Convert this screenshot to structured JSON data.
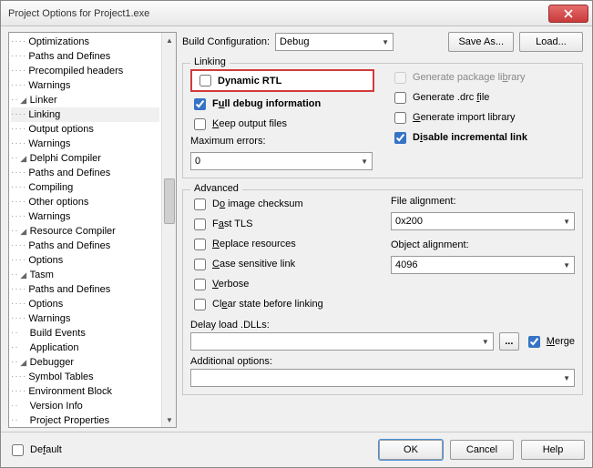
{
  "window": {
    "title": "Project Options for Project1.exe"
  },
  "tree": [
    {
      "indent": 2,
      "label": "Optimizations"
    },
    {
      "indent": 2,
      "label": "Paths and Defines"
    },
    {
      "indent": 2,
      "label": "Precompiled headers"
    },
    {
      "indent": 2,
      "label": "Warnings"
    },
    {
      "indent": 1,
      "label": "Linker",
      "expander": "▾"
    },
    {
      "indent": 2,
      "label": "Linking",
      "selected": true
    },
    {
      "indent": 2,
      "label": "Output options"
    },
    {
      "indent": 2,
      "label": "Warnings"
    },
    {
      "indent": 1,
      "label": "Delphi Compiler",
      "expander": "▾"
    },
    {
      "indent": 2,
      "label": "Paths and Defines"
    },
    {
      "indent": 2,
      "label": "Compiling"
    },
    {
      "indent": 2,
      "label": "Other options"
    },
    {
      "indent": 2,
      "label": "Warnings"
    },
    {
      "indent": 1,
      "label": "Resource Compiler",
      "expander": "▾"
    },
    {
      "indent": 2,
      "label": "Paths and Defines"
    },
    {
      "indent": 2,
      "label": "Options"
    },
    {
      "indent": 1,
      "label": "Tasm",
      "expander": "▾"
    },
    {
      "indent": 2,
      "label": "Paths and Defines"
    },
    {
      "indent": 2,
      "label": "Options"
    },
    {
      "indent": 2,
      "label": "Warnings"
    },
    {
      "indent": 1,
      "label": "Build Events"
    },
    {
      "indent": 1,
      "label": "Application"
    },
    {
      "indent": 1,
      "label": "Debugger",
      "expander": "▾"
    },
    {
      "indent": 2,
      "label": "Symbol Tables"
    },
    {
      "indent": 2,
      "label": "Environment Block"
    },
    {
      "indent": 1,
      "label": "Version Info"
    },
    {
      "indent": 1,
      "label": "Project Properties"
    }
  ],
  "topbar": {
    "build_label": "Build Configuration:",
    "build_value": "Debug",
    "save_as": "Save As...",
    "load": "Load..."
  },
  "linking": {
    "title": "Linking",
    "dynamic_rtl": {
      "pre": "D",
      "mid": "y",
      "post": "namic RTL",
      "checked": false
    },
    "full_debug": {
      "pre": "F",
      "mid": "u",
      "post": "ll debug information",
      "checked": true
    },
    "keep_output": {
      "pre": "",
      "mid": "K",
      "post": "eep output files",
      "checked": false
    },
    "gen_pkg": {
      "pre": "Generate package li",
      "mid": "b",
      "post": "rary",
      "checked": false,
      "disabled": true
    },
    "gen_drc": {
      "pre": "Generate .drc ",
      "mid": "f",
      "post": "ile",
      "checked": false
    },
    "gen_import": {
      "pre": "",
      "mid": "G",
      "post": "enerate import library",
      "checked": false
    },
    "disable_inc": {
      "pre": "D",
      "mid": "i",
      "post": "sable incremental link",
      "checked": true
    },
    "max_errors_label": {
      "pre": "Ma",
      "mid": "x",
      "post": "imum errors:"
    },
    "max_errors_value": "0"
  },
  "advanced": {
    "title": "Advanced",
    "do_image": {
      "pre": "D",
      "mid": "o",
      "post": " image checksum",
      "checked": false
    },
    "fast_tls": {
      "pre": "F",
      "mid": "a",
      "post": "st TLS",
      "checked": false
    },
    "replace": {
      "pre": "",
      "mid": "R",
      "post": "eplace resources",
      "checked": false
    },
    "case_sens": {
      "pre": "",
      "mid": "C",
      "post": "ase sensitive link",
      "checked": false
    },
    "verbose": {
      "pre": "",
      "mid": "V",
      "post": "erbose",
      "checked": false
    },
    "clear_state": {
      "pre": "Cl",
      "mid": "e",
      "post": "ar state before linking",
      "checked": false
    },
    "file_align_label": {
      "pre": "File alig",
      "mid": "n",
      "post": "ment:"
    },
    "file_align_value": "0x200",
    "obj_align_label": {
      "pre": "Ob",
      "mid": "j",
      "post": "ect alignment:"
    },
    "obj_align_value": "4096",
    "delay_label": {
      "pre": "Delay loa",
      "mid": "d",
      "post": " .DLLs:"
    },
    "delay_value": "",
    "browse": "...",
    "merge": {
      "pre": "",
      "mid": "M",
      "post": "erge",
      "checked": true
    },
    "additional_label": {
      "pre": "Addi",
      "mid": "t",
      "post": "ional options:"
    },
    "additional_value": ""
  },
  "footer": {
    "default": {
      "pre": "De",
      "mid": "f",
      "post": "ault",
      "checked": false
    },
    "ok": "OK",
    "cancel": "Cancel",
    "help": "Help"
  }
}
